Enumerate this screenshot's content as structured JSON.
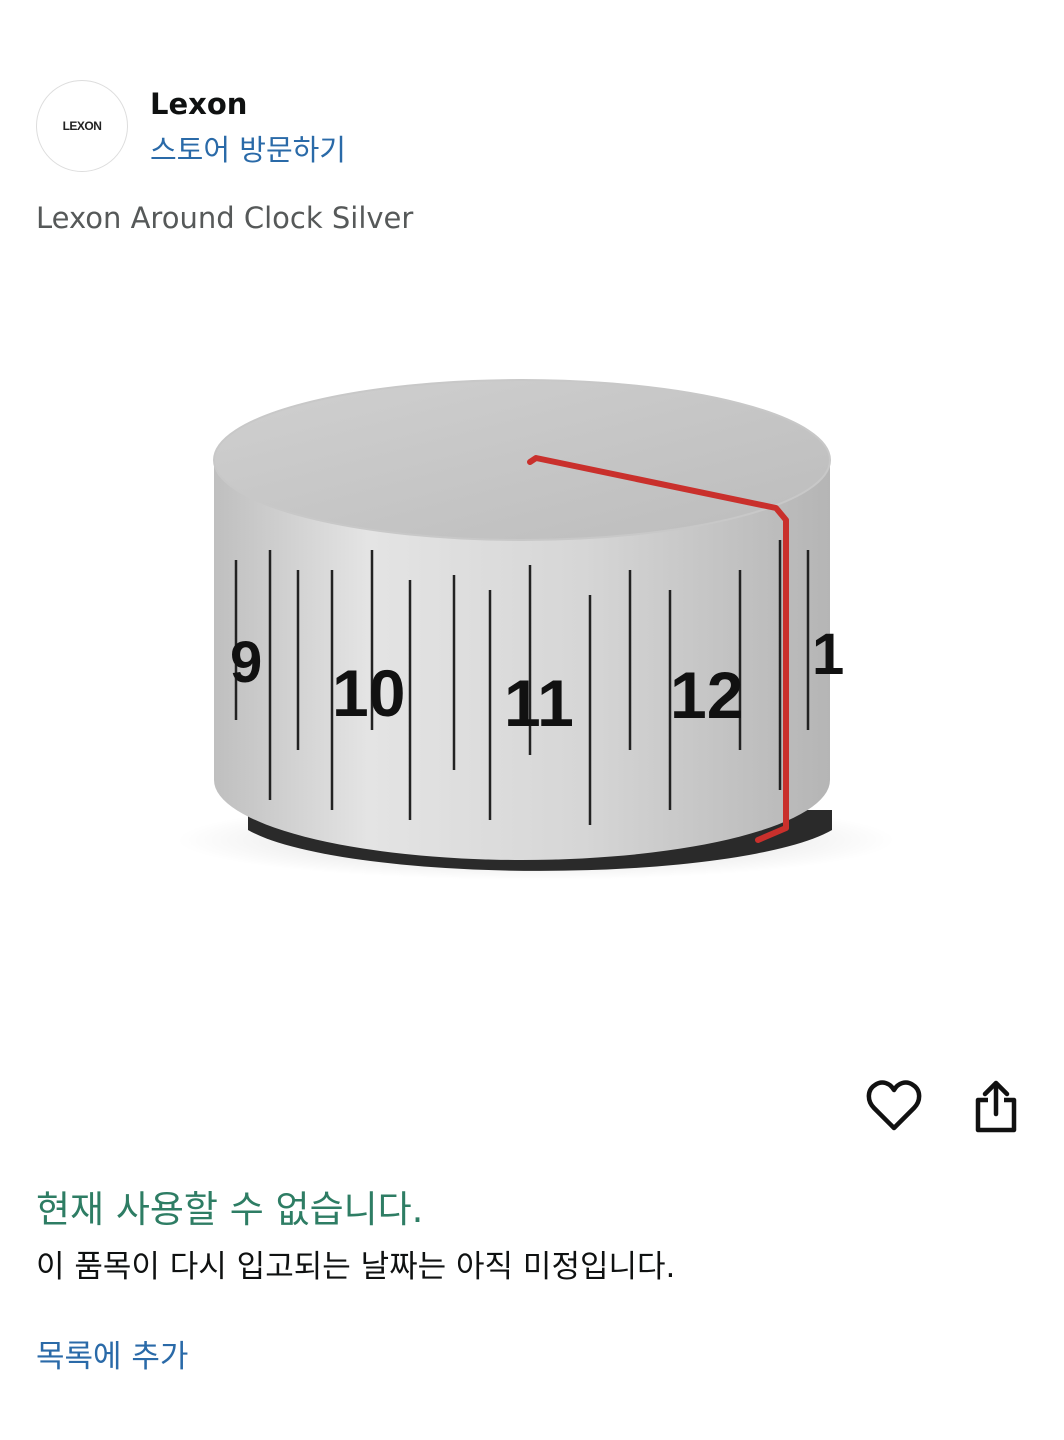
{
  "brand": {
    "logo_text": "LEXON",
    "name": "Lexon",
    "store_link": "스토어 방문하기"
  },
  "product": {
    "title": "Lexon Around Clock Silver",
    "image": {
      "description_icon": "cylinder-clock-product-photo",
      "dial_numbers": [
        "9",
        "10",
        "11",
        "12",
        "1"
      ],
      "hand_color": "#c9302c",
      "body_color": "#d9d9d9"
    }
  },
  "actions": {
    "wishlist_icon": "heart-icon",
    "share_icon": "share-icon"
  },
  "availability": {
    "status": "현재 사용할 수 없습니다.",
    "detail": "이 품목이 다시 입고되는 날짜는 아직 미정입니다.",
    "status_color": "#2e7d64"
  },
  "list": {
    "add_label": "목록에 추가"
  }
}
